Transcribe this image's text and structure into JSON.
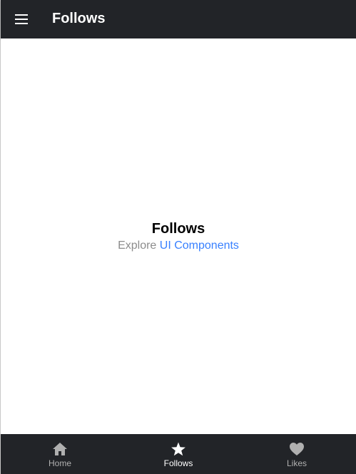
{
  "header": {
    "title": "Follows",
    "menu_icon": "menu-icon"
  },
  "main": {
    "title": "Follows",
    "explore_text": "Explore",
    "link_text": "UI Components"
  },
  "tabs": [
    {
      "label": "Home",
      "icon": "home-icon",
      "selected": false
    },
    {
      "label": "Follows",
      "icon": "star-icon",
      "selected": true
    },
    {
      "label": "Likes",
      "icon": "heart-icon",
      "selected": false
    }
  ],
  "colors": {
    "bar_background": "#222428",
    "link": "#3880ff",
    "muted_text": "#8c8c8c",
    "tab_inactive": "#b0b0b0",
    "tab_active": "#ffffff"
  }
}
